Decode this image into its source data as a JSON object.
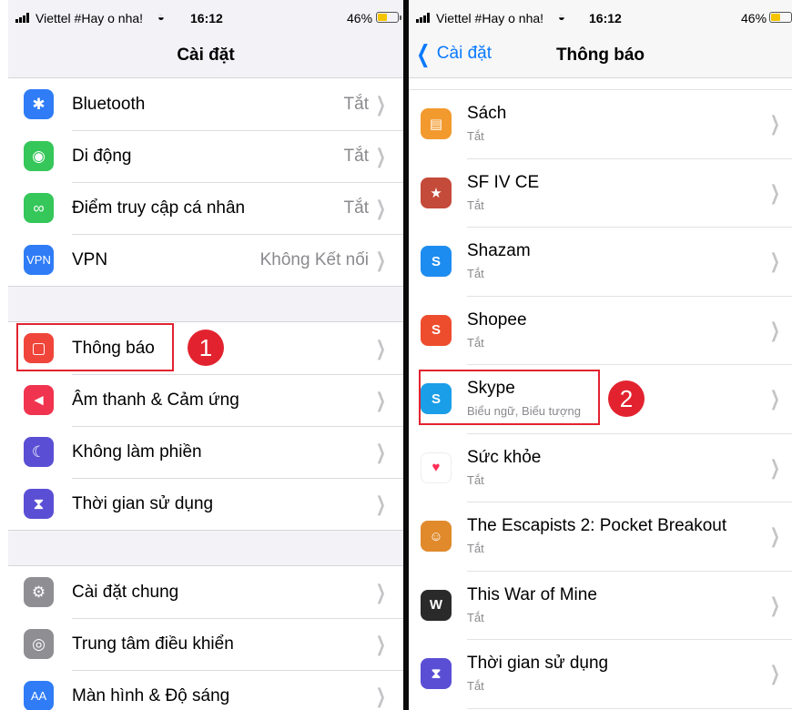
{
  "left": {
    "status": {
      "carrier": "Viettel #Hay o nha!",
      "time": "16:12",
      "battery": "46%"
    },
    "title": "Cài đặt",
    "group1": [
      {
        "label": "Bluetooth",
        "value": "Tắt",
        "icon": "bluetooth-icon",
        "color": "#2f7cf6"
      },
      {
        "label": "Di động",
        "value": "Tắt",
        "icon": "cellular-icon",
        "color": "#35c759"
      },
      {
        "label": "Điểm truy cập cá nhân",
        "value": "Tắt",
        "icon": "hotspot-icon",
        "color": "#35c759"
      },
      {
        "label": "VPN",
        "value": "Không Kết nối",
        "icon": "vpn-icon",
        "color": "#2f7cf6",
        "icon_text": "VPN"
      }
    ],
    "group2": [
      {
        "label": "Thông báo",
        "icon": "notifications-icon",
        "color": "#f0453a"
      },
      {
        "label": "Âm thanh & Cảm ứng",
        "icon": "sound-icon",
        "color": "#f0344f"
      },
      {
        "label": "Không làm phiền",
        "icon": "moon-icon",
        "color": "#5a4fd4"
      },
      {
        "label": "Thời gian sử dụng",
        "icon": "hourglass-icon",
        "color": "#5a4fd4"
      }
    ],
    "group3": [
      {
        "label": "Cài đặt chung",
        "icon": "gear-icon",
        "color": "#8e8e93"
      },
      {
        "label": "Trung tâm điều khiển",
        "icon": "switches-icon",
        "color": "#8e8e93"
      },
      {
        "label": "Màn hình & Độ sáng",
        "icon": "brightness-icon",
        "color": "#2f7cf6",
        "icon_text": "AA"
      }
    ],
    "step_badge": "1"
  },
  "right": {
    "status": {
      "carrier": "Viettel #Hay o nha!",
      "time": "16:12",
      "battery": "46%"
    },
    "back_label": "Cài đặt",
    "title": "Thông báo",
    "apps": [
      {
        "name": "Sách",
        "sub": "Tắt",
        "icon": "books-icon",
        "color": "#f29a2e"
      },
      {
        "name": "SF IV CE",
        "sub": "Tắt",
        "icon": "sf4-icon",
        "color": "#c44a3a"
      },
      {
        "name": "Shazam",
        "sub": "Tắt",
        "icon": "shazam-icon",
        "color": "#1d8cf0"
      },
      {
        "name": "Shopee",
        "sub": "Tắt",
        "icon": "shopee-icon",
        "color": "#ee4d2d"
      },
      {
        "name": "Skype",
        "sub": "Biểu ngữ, Biểu tượng",
        "icon": "skype-icon",
        "color": "#1a9ee8"
      },
      {
        "name": "Sức khỏe",
        "sub": "Tắt",
        "icon": "health-icon",
        "color": "#ffffff"
      },
      {
        "name": "The Escapists 2: Pocket Breakout",
        "sub": "Tắt",
        "icon": "escapists-icon",
        "color": "#e08a2c"
      },
      {
        "name": "This War of Mine",
        "sub": "Tắt",
        "icon": "war-icon",
        "color": "#2a2a2a"
      },
      {
        "name": "Thời gian sử dụng",
        "sub": "Tắt",
        "icon": "hourglass-icon",
        "color": "#5a4fd4"
      }
    ],
    "step_badge": "2"
  }
}
